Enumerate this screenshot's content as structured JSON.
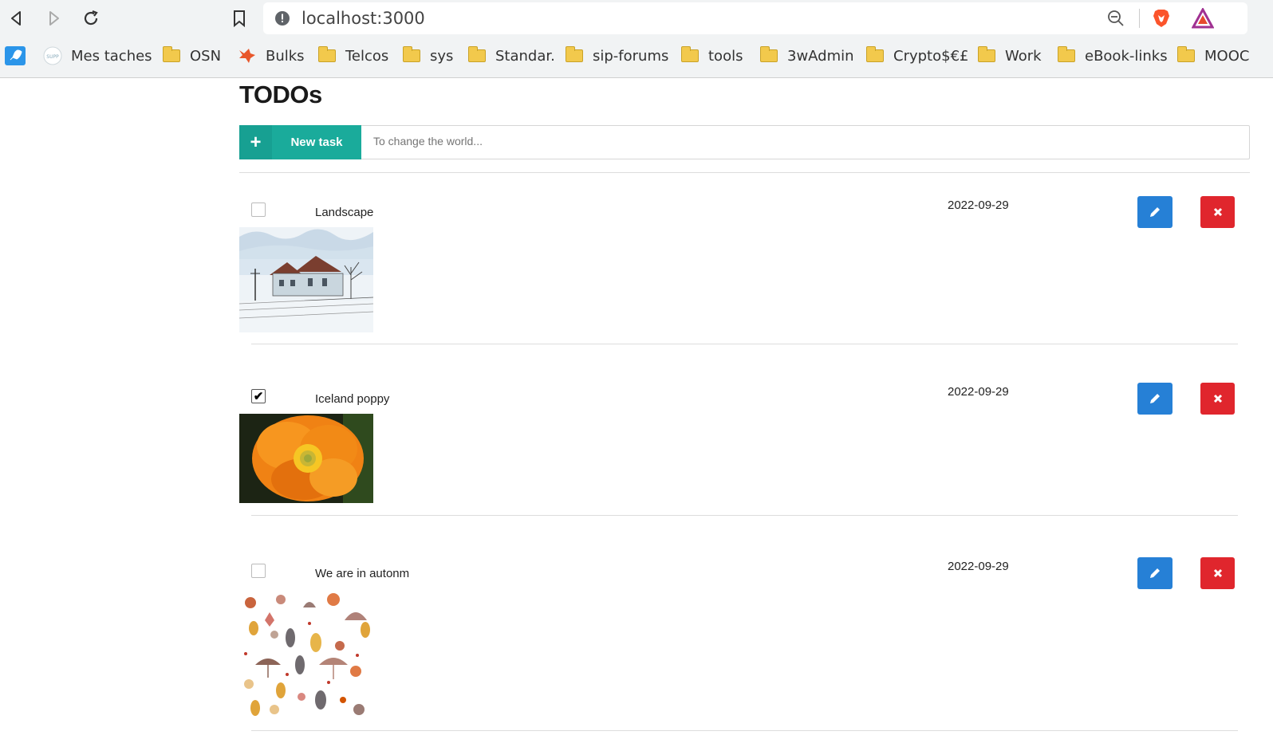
{
  "browser": {
    "url": "localhost:3000",
    "bookmarks": [
      "Mes taches",
      "OSN",
      "Bulks",
      "Telcos",
      "sys",
      "Standar.",
      "sip-forums",
      "tools",
      "3wAdmin",
      "Crypto$€£",
      "Work",
      "eBook-links",
      "MOOC"
    ]
  },
  "page": {
    "title": "TODOs",
    "new_task_label": "New task",
    "new_task_placeholder": "To change the world..."
  },
  "tasks": [
    {
      "label": "Landscape",
      "date": "2022-09-29",
      "done": false,
      "image": "winter-train-station-sketch"
    },
    {
      "label": "Iceland poppy",
      "date": "2022-09-29",
      "done": true,
      "image": "orange-poppy-flower"
    },
    {
      "label": "We are in autonm",
      "date": "2022-09-29",
      "done": false,
      "image": "autumn-leaves-pattern"
    }
  ],
  "colors": {
    "accent": "#1aab9b",
    "edit": "#2680d6",
    "delete": "#e0262d"
  }
}
